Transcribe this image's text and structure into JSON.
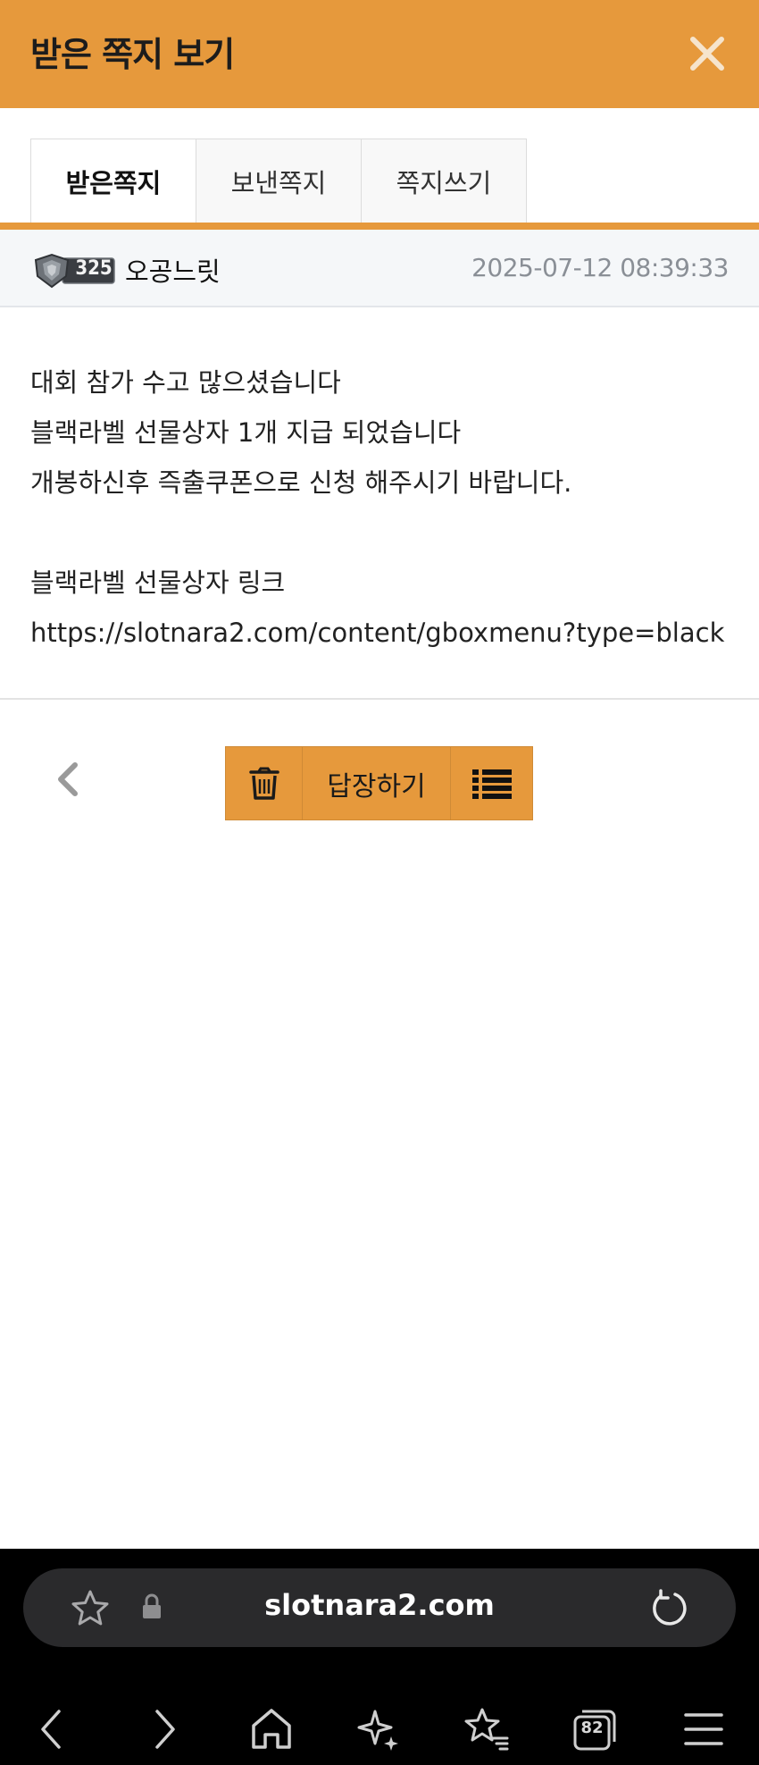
{
  "header": {
    "title": "받은 쪽지 보기",
    "close_icon": "close-icon"
  },
  "tabs": [
    {
      "label": "받은쪽지",
      "active": true
    },
    {
      "label": "보낸쪽지",
      "active": false
    },
    {
      "label": "쪽지쓰기",
      "active": false
    }
  ],
  "message": {
    "level": "325",
    "sender": "오공느릿",
    "datetime": "2025-07-12 08:39:33",
    "lines": [
      "대회 참가 수고 많으셨습니다",
      "블랙라벨 선물상자 1개 지급 되었습니다",
      "개봉하신후 즉출쿠폰으로 신청 해주시기 바랍니다.",
      "",
      "블랙라벨 선물상자 링크",
      "https://slotnara2.com/content/gboxmenu?type=black"
    ]
  },
  "actions": {
    "back_icon": "chevron-left-icon",
    "delete_icon": "trash-icon",
    "reply_label": "답장하기",
    "list_icon": "list-icon"
  },
  "browser": {
    "url": "slotnara2.com",
    "tab_count": "82",
    "icons": [
      "star-icon",
      "lock-icon",
      "reload-icon",
      "back-icon",
      "forward-icon",
      "home-icon",
      "sparkle-icon",
      "bookmarks-icon",
      "tabs-icon",
      "menu-icon"
    ]
  },
  "colors": {
    "accent": "#e6993c",
    "browser_bg": "#000000",
    "url_pill": "#2a2a2c"
  }
}
